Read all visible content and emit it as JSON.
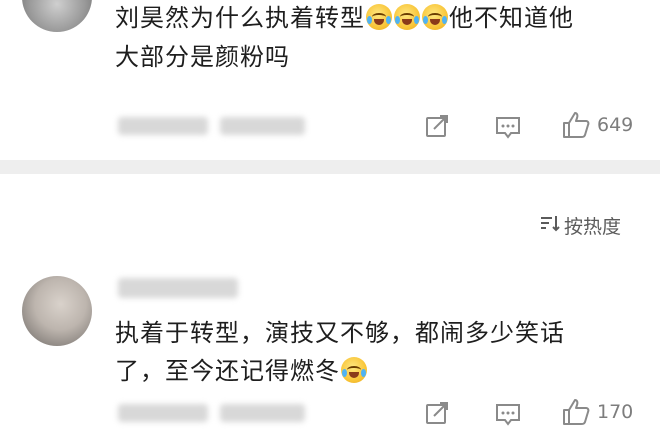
{
  "comments": [
    {
      "text_line1": "刘昊然为什么执着转型",
      "text_line1_after": "他不知道他",
      "text_line2": "大部分是颜粉吗",
      "like_count": "649"
    },
    {
      "text_line1": "执着于转型，演技又不够，都闹多少笑话",
      "text_line2": "了，至今还记得燃冬",
      "like_count": "170"
    }
  ],
  "sort": {
    "label": "按热度",
    "icon": "sort-lines-icon"
  },
  "icons": {
    "share": "share-icon",
    "comment": "comment-icon",
    "like": "thumbs-up-icon",
    "emoji": "laugh-cry-emoji"
  }
}
